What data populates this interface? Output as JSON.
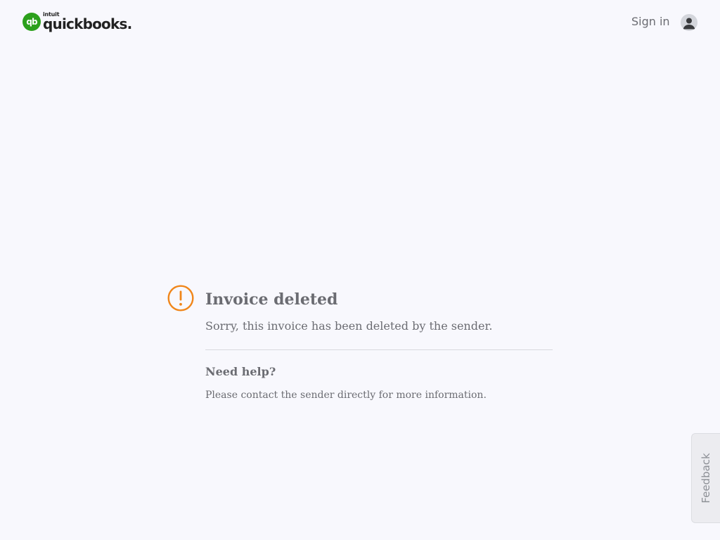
{
  "header": {
    "logo": {
      "intuit_text": "intuit",
      "wordmark": "quickbooks",
      "badge_text": "qb",
      "brand_color": "#2ca01c"
    },
    "sign_in_label": "Sign in",
    "avatar_icon": "user-avatar-icon"
  },
  "message": {
    "icon": "exclamation-circle-icon",
    "icon_color": "#f0861a",
    "title": "Invoice deleted",
    "subtitle": "Sorry, this invoice has been deleted by the sender.",
    "help_heading": "Need help?",
    "help_text": "Please contact the sender directly for more information."
  },
  "feedback": {
    "label": "Feedback"
  }
}
